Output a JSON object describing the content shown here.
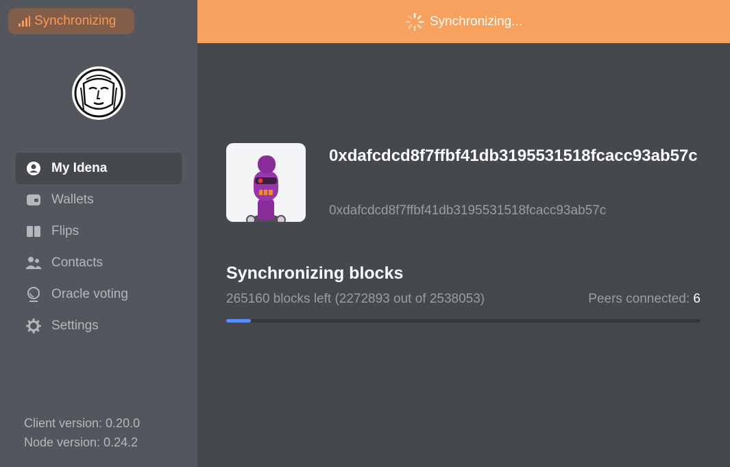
{
  "sidebar": {
    "sync_badge": "Synchronizing",
    "nav": [
      {
        "label": "My Idena",
        "icon": "user-circle-icon"
      },
      {
        "label": "Wallets",
        "icon": "wallet-icon"
      },
      {
        "label": "Flips",
        "icon": "flips-icon"
      },
      {
        "label": "Contacts",
        "icon": "contacts-icon"
      },
      {
        "label": "Oracle voting",
        "icon": "oracle-icon"
      },
      {
        "label": "Settings",
        "icon": "gear-icon"
      }
    ],
    "client_version": "Client version: 0.20.0",
    "node_version": "Node version: 0.24.2"
  },
  "banner": {
    "text": "Synchronizing..."
  },
  "profile": {
    "address": "0xdafcdcd8f7ffbf41db3195531518fcacc93ab57c",
    "address_sub": "0xdafcdcd8f7ffbf41db3195531518fcacc93ab57c"
  },
  "sync": {
    "title": "Synchronizing blocks",
    "blocks_left": "265160 blocks left (2272893 out of 2538053)",
    "peers_label": "Peers connected:",
    "peers_count": "6",
    "current_block": 2272893,
    "highest_block": 2538053,
    "progress_fraction": 0.052
  },
  "colors": {
    "accent_orange": "#f7a15e",
    "progress_blue": "#578fff"
  }
}
